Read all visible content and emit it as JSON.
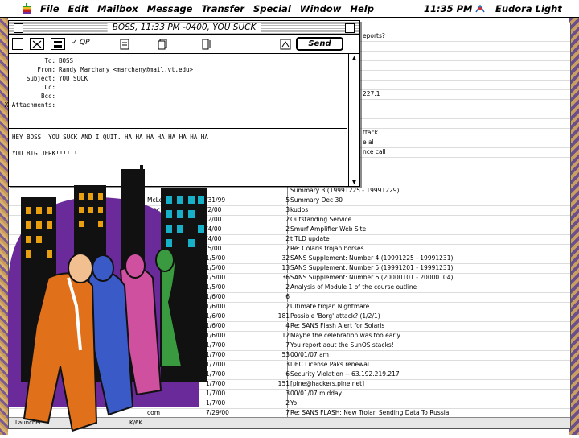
{
  "menubar": {
    "items": [
      "File",
      "Edit",
      "Mailbox",
      "Message",
      "Transfer",
      "Special",
      "Window",
      "Help"
    ],
    "clock": "11:35 PM",
    "app_name": "Eudora Light",
    "icons": [
      "apple-icon",
      "eudora-app-icon"
    ]
  },
  "message_window": {
    "title": "BOSS, 11:33 PM -0400, YOU SUCK",
    "toolbar": {
      "qp_label": "QP",
      "send_label": "Send",
      "icons": [
        "tab-icon",
        "binhex-icon",
        "qp-checkmark-icon",
        "text-doc-icon",
        "keep-copy-icon",
        "word-wrap-icon",
        "signature-icon"
      ]
    },
    "headers": [
      {
        "label": "To:",
        "value": "BOSS"
      },
      {
        "label": "From:",
        "value": "Randy Marchany <marchany@mail.vt.edu>"
      },
      {
        "label": "Subject:",
        "value": "YOU SUCK"
      },
      {
        "label": "Cc:",
        "value": ""
      },
      {
        "label": "Bcc:",
        "value": ""
      },
      {
        "label": "X-Attachments:",
        "value": ""
      }
    ],
    "body_lines": [
      "HEY BOSS! YOU SUCK AND I QUIT. HA HA HA HA HA HA HA HA",
      "",
      "YOU BIG JERK!!!!!!"
    ]
  },
  "mailbox_list": {
    "partial_top": [
      {
        "text": "eports?"
      },
      {
        "text": "227.1"
      },
      {
        "text": "ttack"
      },
      {
        "text": "e al"
      },
      {
        "text": "nce call"
      }
    ],
    "rows": [
      {
        "who": "",
        "date": "",
        "size": "",
        "subject": "Summary 3 (19991225 - 19991229)"
      },
      {
        "who": "McLe",
        "date": "/31/99",
        "size": "5",
        "subject": "Summary Dec 30"
      },
      {
        "who": "mac",
        "date": "/2/00",
        "size": "3",
        "subject": "kudos"
      },
      {
        "who": "",
        "date": "/2/00",
        "size": "2",
        "subject": "Outstanding Service"
      },
      {
        "who": "",
        "date": "/4/00",
        "size": "2",
        "subject": "Smurf Amplifier Web Site"
      },
      {
        "who": "",
        "date": "/4/00",
        "size": "2",
        "subject": "t TLD update"
      },
      {
        "who": "",
        "date": "/5/00",
        "size": "2",
        "subject": "Re: Colaris trojan horses"
      },
      {
        "who": "",
        "date": "1/5/00",
        "size": "32",
        "subject": "SANS Supplement: Number 4 (19991225 - 19991231)"
      },
      {
        "who": "",
        "date": "1/5/00",
        "size": "13",
        "subject": "SANS Supplement: Number 5 (19991201 - 19991231)"
      },
      {
        "who": "",
        "date": "1/5/00",
        "size": "36",
        "subject": "SANS Supplement: Number 6 (20000101 - 20000104)"
      },
      {
        "who": "",
        "date": "1/5/00",
        "size": "2",
        "subject": "Analysis of Module 1 of the course outline"
      },
      {
        "who": "",
        "date": "1/6/00",
        "size": "6",
        "subject": ""
      },
      {
        "who": "",
        "date": "1/6/00",
        "size": "2",
        "subject": "Ultimate trojan Nightmare"
      },
      {
        "who": "",
        "date": "1/6/00",
        "size": "181",
        "subject": "Possible 'Borg' attack? (1/2/1)"
      },
      {
        "who": "",
        "date": "1/6/00",
        "size": "4",
        "subject": "Re: SANS Flash Alert for Solaris"
      },
      {
        "who": "",
        "date": "1/6/00",
        "size": "12",
        "subject": "Maybe the celebration was too early"
      },
      {
        "who": "",
        "date": "1/7/00",
        "size": "7",
        "subject": "You report aout the SunOS stacks!"
      },
      {
        "who": "",
        "date": "1/7/00",
        "size": "53",
        "subject": "00/01/07 am"
      },
      {
        "who": "",
        "date": "1/7/00",
        "size": "3",
        "subject": "DEC License Paks renewal"
      },
      {
        "who": "",
        "date": "1/7/00",
        "size": "6",
        "subject": "Security Violation -- 63.192.219.217"
      },
      {
        "who": "",
        "date": "1/7/00",
        "size": "151",
        "subject": "[pine@hackers.pine.net]"
      },
      {
        "who": "",
        "date": "1/7/00",
        "size": "3",
        "subject": "00/01/07 midday"
      },
      {
        "who": "",
        "date": "1/7/00",
        "size": "2",
        "subject": "Yo!"
      },
      {
        "who": "com",
        "date": "7/29/00",
        "size": "7",
        "subject": "Re: SANS FLASH: New Trojan Sending Data To Russia"
      }
    ],
    "status": {
      "left": "Launcher",
      "mid": "K/6K"
    }
  },
  "clipart": {
    "description_name": "office-workers-cityscape-clipart"
  }
}
